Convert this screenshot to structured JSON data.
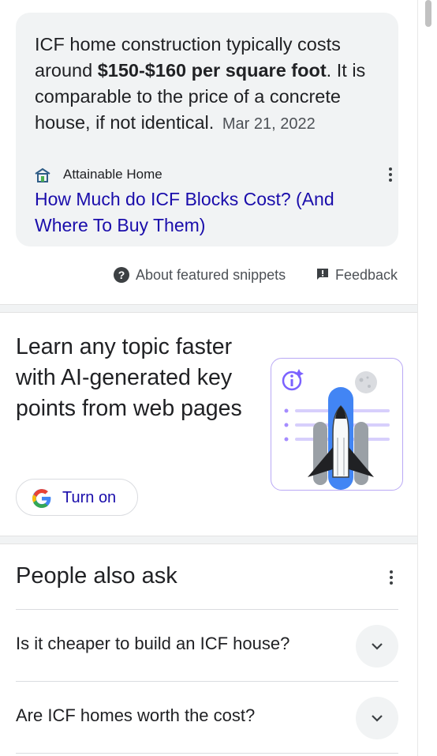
{
  "snippet": {
    "text_before": "ICF home construction typically costs around ",
    "text_bold": "$150-$160 per square foot",
    "text_after": ". It is comparable to the price of a concrete house, if not identical.",
    "date": "Mar 21, 2022",
    "source_name": "Attainable Home",
    "link_title": "How Much do ICF Blocks Cost? (And Where To Buy Them)"
  },
  "snippet_footer": {
    "about_label": "About featured snippets",
    "feedback_label": "Feedback"
  },
  "promo": {
    "heading": "Learn any topic faster with AI-generated key points from web pages",
    "button_label": "Turn on"
  },
  "people_also_ask": {
    "title": "People also ask",
    "questions": [
      "Is it cheaper to build an ICF house?",
      "Are ICF homes worth the cost?"
    ]
  },
  "colors": {
    "link": "#1a0dab",
    "card_bg": "#f1f3f4",
    "accent_purple": "#b9a8f5",
    "google_blue": "#4285f4"
  },
  "icons": {
    "source_favicon": "attainable-home-favicon",
    "more": "three-dots-vertical-icon",
    "about": "question-circle-icon",
    "feedback": "feedback-flag-icon",
    "google": "google-g-logo",
    "chevron": "chevron-down-icon"
  }
}
